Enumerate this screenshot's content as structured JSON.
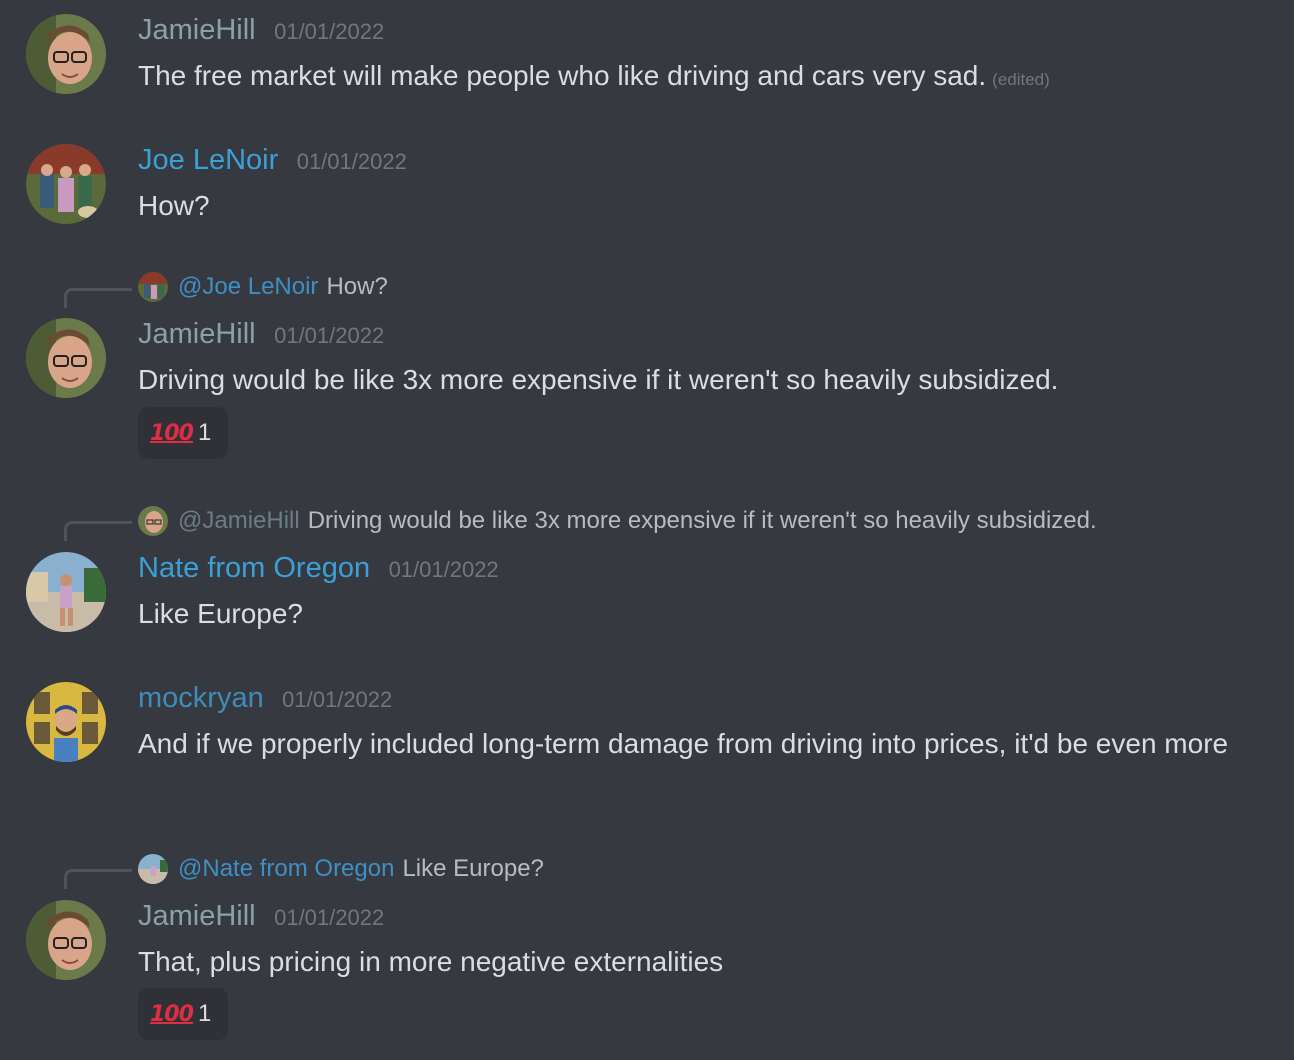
{
  "colors": {
    "background": "#36393f",
    "text": "#dcddde",
    "timestamp": "#72767d",
    "jamie_name": "#8aa1a9",
    "joe_name": "#3ca0d8",
    "nate_name": "#3ca0d8",
    "mock_name": "#3f8cb8",
    "reaction_bg": "#2f3136"
  },
  "messages": [
    {
      "author": "JamieHill",
      "timestamp": "01/01/2022",
      "text": "The free market will make people who like driving and cars very sad.",
      "edited": "(edited)"
    },
    {
      "author": "Joe LeNoir",
      "timestamp": "01/01/2022",
      "text": "How?"
    },
    {
      "reply": {
        "mention": "@Joe LeNoir",
        "quote": "How?"
      },
      "author": "JamieHill",
      "timestamp": "01/01/2022",
      "text": "Driving would be like 3x more expensive if it weren't so heavily subsidized.",
      "reaction": {
        "emoji": "100",
        "count": "1"
      }
    },
    {
      "reply": {
        "mention": "@JamieHill",
        "quote": "Driving would be like 3x more expensive if it weren't so heavily subsidized."
      },
      "author": "Nate from Oregon",
      "timestamp": "01/01/2022",
      "text": "Like Europe?"
    },
    {
      "author": "mockryan",
      "timestamp": "01/01/2022",
      "text": "And if we properly included long-term damage from driving into prices, it'd be even more"
    },
    {
      "reply": {
        "mention": "@Nate from Oregon",
        "quote": "Like Europe?"
      },
      "author": "JamieHill",
      "timestamp": "01/01/2022",
      "text": "That, plus pricing in more negative externalities",
      "reaction": {
        "emoji": "100",
        "count": "1"
      }
    }
  ]
}
